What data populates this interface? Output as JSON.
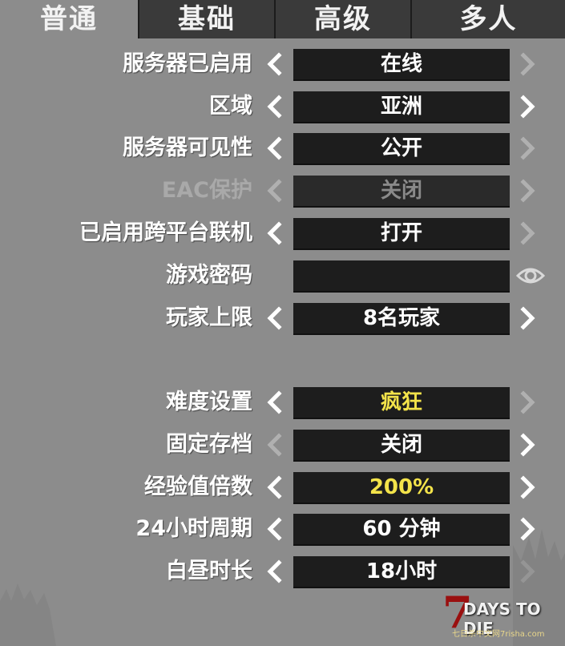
{
  "tabs": [
    {
      "label": "普通",
      "active": true
    },
    {
      "label": "基础",
      "active": false
    },
    {
      "label": "高级",
      "active": false
    },
    {
      "label": "多人",
      "active": false
    }
  ],
  "settings": [
    {
      "label": "服务器已启用",
      "value": "在线",
      "enabled": true,
      "left": true,
      "right": false,
      "highlight": false
    },
    {
      "label": "区域",
      "value": "亚洲",
      "enabled": true,
      "left": true,
      "right": true,
      "highlight": false
    },
    {
      "label": "服务器可见性",
      "value": "公开",
      "enabled": true,
      "left": true,
      "right": false,
      "highlight": false
    },
    {
      "label": "EAC保护",
      "value": "关闭",
      "enabled": false,
      "left": false,
      "right": false,
      "highlight": false
    },
    {
      "label": "已启用跨平台联机",
      "value": "打开",
      "enabled": true,
      "left": true,
      "right": false,
      "highlight": false
    },
    {
      "label": "游戏密码",
      "value": "",
      "enabled": true,
      "password": true
    },
    {
      "label": "玩家上限",
      "value": "8名玩家",
      "enabled": true,
      "left": true,
      "right": true,
      "highlight": false
    },
    {
      "label": "难度设置",
      "value": "疯狂",
      "enabled": true,
      "left": true,
      "right": false,
      "highlight": true
    },
    {
      "label": "固定存档",
      "value": "关闭",
      "enabled": true,
      "left": false,
      "right": true,
      "highlight": false
    },
    {
      "label": "经验值倍数",
      "value": "200%",
      "enabled": true,
      "left": true,
      "right": true,
      "highlight": true
    },
    {
      "label": "24小时周期",
      "value": "60 分钟",
      "enabled": true,
      "left": true,
      "right": true,
      "highlight": false
    },
    {
      "label": "白昼时长",
      "value": "18小时",
      "enabled": true,
      "left": true,
      "right": false,
      "highlight": false
    }
  ],
  "logo": {
    "seven": "7",
    "text": "DAYS TO DIE",
    "sub": "七日杀中文网7risha.com"
  },
  "colors": {
    "active_arrow": "#ffffff",
    "inactive_arrow": "#b0b0b0",
    "highlight": "#f3e34a",
    "value_bg": "#1d1d1d"
  }
}
